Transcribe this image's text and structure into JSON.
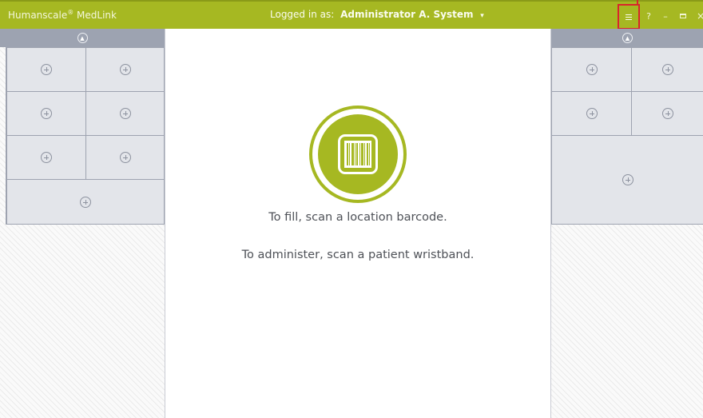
{
  "titlebar": {
    "app_name": "Humanscale",
    "app_name_mark": "®",
    "app_product": "MedLink",
    "login_prefix": "Logged in as:",
    "user_name": "Administrator A. System",
    "user_caret": "▾",
    "help": "?",
    "minimize": "–",
    "close": "×"
  },
  "center": {
    "message_fill": "To fill, scan a location barcode.",
    "message_administer": "To administer, scan a patient wristband."
  },
  "colors": {
    "brand_green": "#a6b822",
    "panel_header": "#9da3b1",
    "drawer_cell": "#e3e5ea",
    "highlight_red": "#d9252b"
  },
  "icons": {
    "scan": "barcode-scan-icon",
    "add_drawer": "add-circle-icon",
    "panel_up": "chevron-up-circle-icon",
    "menu": "hamburger-menu-icon"
  }
}
